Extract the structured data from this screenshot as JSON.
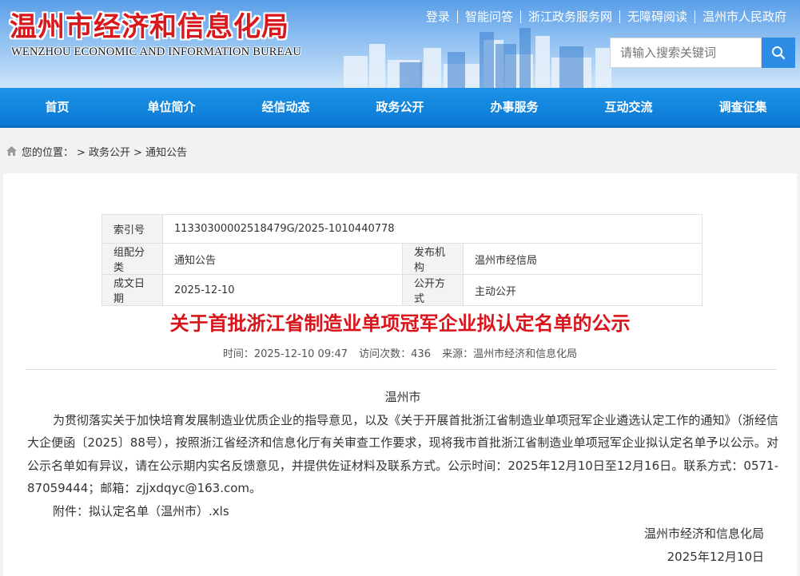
{
  "header": {
    "title_cn": "温州市经济和信息化局",
    "title_en": "WENZHOU ECONOMIC AND INFORMATION BUREAU",
    "top_links": [
      "登录",
      "智能问答",
      "浙江政务服务网",
      "无障碍阅读",
      "温州市人民政府"
    ],
    "search_placeholder": "请输入搜索关键词"
  },
  "nav": [
    "首页",
    "单位简介",
    "经信动态",
    "政务公开",
    "办事服务",
    "互动交流",
    "调查征集"
  ],
  "breadcrumb": {
    "label": "您的位置：",
    "items": [
      "> 政务公开",
      "> 通知公告"
    ]
  },
  "meta": {
    "index_label": "索引号",
    "index_value": "11330300002518479G/2025-1010440778",
    "category_label": "组配分类",
    "category_value": "通知公告",
    "publisher_label": "发布机构",
    "publisher_value": "温州市经信局",
    "date_label": "成文日期",
    "date_value": "2025-12-10",
    "open_label": "公开方式",
    "open_value": "主动公开"
  },
  "article": {
    "title": "关于首批浙江省制造业单项冠军企业拟认定名单的公示",
    "time": "时间：2025-12-10 09:47",
    "views": "访问次数：436",
    "source": "来源：温州市经济和信息化局",
    "salutation": "温州市",
    "paragraph": "为贯彻落实关于加快培育发展制造业优质企业的指导意见，以及《关于开展首批浙江省制造业单项冠军企业遴选认定工作的通知》（浙经信大企便函〔2025〕88号），按照浙江省经济和信息化厅有关审查工作要求，现将我市首批浙江省制造业单项冠军企业拟认定名单予以公示。对公示名单如有异议，请在公示期内实名反馈意见，并提供佐证材料及联系方式。公示时间：2025年12月10日至12月16日。联系方式：0571-87059444；邮箱：zjjxdqyc@163.com。",
    "attachment": "附件：拟认定名单（温州市）.xls",
    "signature": "温州市经济和信息化局",
    "sign_date": "2025年12月10日"
  },
  "colors": {
    "brand_red": "#d8181d",
    "nav_blue": "#0b79d4",
    "title_red": "#d9141b"
  }
}
